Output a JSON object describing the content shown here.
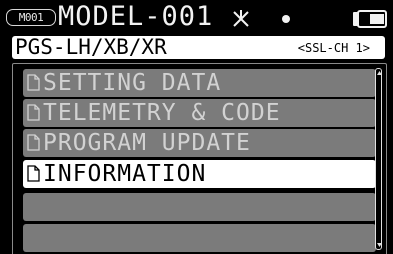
{
  "header": {
    "model_badge": "M001",
    "model_name": "MODEL-001",
    "icons": [
      "antenna-icon",
      "dot-icon",
      "battery-icon"
    ]
  },
  "receiver": {
    "title": "PGS-LH/XB/XR",
    "channel": "<SSL-CH 1>"
  },
  "menu": {
    "items": [
      {
        "label": "SETTING DATA",
        "icon": "document-icon",
        "state": "normal"
      },
      {
        "label": "TELEMETRY & CODE",
        "icon": "document-icon",
        "state": "normal"
      },
      {
        "label": "PROGRAM UPDATE",
        "icon": "document-icon",
        "state": "normal"
      },
      {
        "label": "INFORMATION",
        "icon": "document-icon",
        "state": "selected"
      },
      {
        "label": "",
        "state": "empty"
      },
      {
        "label": "",
        "state": "empty"
      }
    ]
  },
  "colors": {
    "background": "#000000",
    "item_normal": "#7b7b7b",
    "item_selected": "#ffffff",
    "text_light": "#f2f2f2"
  }
}
